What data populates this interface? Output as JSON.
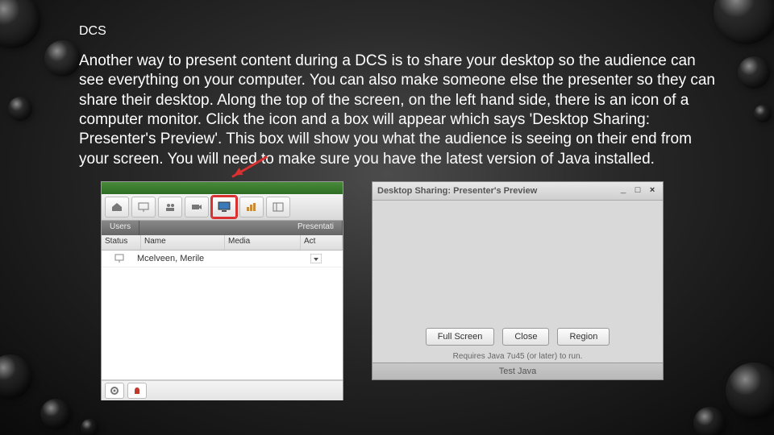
{
  "title": "DCS",
  "paragraph": "Another way to present content during a DCS is to share your desktop so the audience can see everything on your computer. You can also make someone else the presenter so they can share their desktop.  Along the top of the screen, on the left hand side, there is an icon of a computer monitor. Click the icon and a box will appear which says 'Desktop Sharing: Presenter's Preview'. This box will show you what the audience is seeing on their end from your screen. You will need to make sure you have the latest version of Java installed.",
  "app1": {
    "tabs": {
      "users": "Users",
      "present": "Presentati"
    },
    "columns": {
      "status": "Status",
      "name": "Name",
      "media": "Media",
      "act": "Act"
    },
    "row1_name": "Mcelveen, Merile"
  },
  "app2": {
    "title": "Desktop Sharing: Presenter's Preview",
    "buttons": {
      "full": "Full Screen",
      "close": "Close",
      "region": "Region"
    },
    "note": "Requires Java 7u45 (or later) to run.",
    "footer": "Test Java"
  }
}
